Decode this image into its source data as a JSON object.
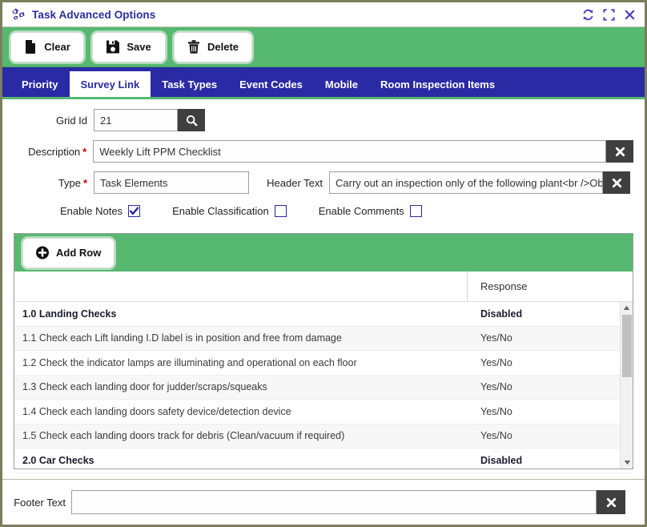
{
  "window": {
    "title": "Task Advanced Options",
    "icon": "gears-icon",
    "actions": [
      {
        "name": "refresh-icon",
        "label": "Refresh"
      },
      {
        "name": "maximize-icon",
        "label": "Maximize"
      },
      {
        "name": "close-icon",
        "label": "Close"
      }
    ]
  },
  "toolbar": {
    "clear_label": "Clear",
    "save_label": "Save",
    "delete_label": "Delete"
  },
  "tabs": [
    {
      "label": "Priority",
      "active": false
    },
    {
      "label": "Survey Link",
      "active": true
    },
    {
      "label": "Task Types",
      "active": false
    },
    {
      "label": "Event Codes",
      "active": false
    },
    {
      "label": "Mobile",
      "active": false
    },
    {
      "label": "Room Inspection Items",
      "active": false
    }
  ],
  "form": {
    "grid_id": {
      "label": "Grid Id",
      "value": "21",
      "search_icon": "search-icon"
    },
    "description": {
      "label": "Description",
      "required": "*",
      "value": "Weekly Lift PPM Checklist",
      "clear_icon": "clear-x-icon"
    },
    "type": {
      "label": "Type",
      "required": "*",
      "value": "Task Elements"
    },
    "header_text": {
      "label": "Header Text",
      "value": "Carry out an inspection only of the following plant<br />Ob",
      "clear_icon": "clear-x-icon"
    },
    "checkboxes": [
      {
        "label": "Enable Notes",
        "checked": true
      },
      {
        "label": "Enable Classification",
        "checked": false
      },
      {
        "label": "Enable Comments",
        "checked": false
      }
    ]
  },
  "grid": {
    "add_row_label": "Add Row",
    "columns": [
      "",
      "Response"
    ],
    "rows": [
      {
        "text": "1.0 Landing Checks",
        "response": "Disabled",
        "section": true
      },
      {
        "text": "1.1 Check each Lift landing I.D label is in position and free from damage",
        "response": "Yes/No",
        "section": false
      },
      {
        "text": "1.2 Check the indicator lamps are illuminating and operational on each floor",
        "response": "Yes/No",
        "section": false
      },
      {
        "text": "1.3 Check each landing door for judder/scraps/squeaks",
        "response": "Yes/No",
        "section": false
      },
      {
        "text": "1.4 Check each landing doors safety device/detection device",
        "response": "Yes/No",
        "section": false
      },
      {
        "text": "1.5 Check each landing doors track for debris (Clean/vacuum if required)",
        "response": "Yes/No",
        "section": false
      },
      {
        "text": "2.0 Car Checks",
        "response": "Disabled",
        "section": true
      }
    ]
  },
  "footer": {
    "label": "Footer Text",
    "value": "",
    "placeholder": "",
    "clear_icon": "clear-x-icon"
  },
  "colors": {
    "green": "#57b870",
    "navy": "#2a2aa5",
    "dark_button": "#3f3f3f",
    "frame": "#7d7d5e",
    "required": "#cc0000"
  }
}
